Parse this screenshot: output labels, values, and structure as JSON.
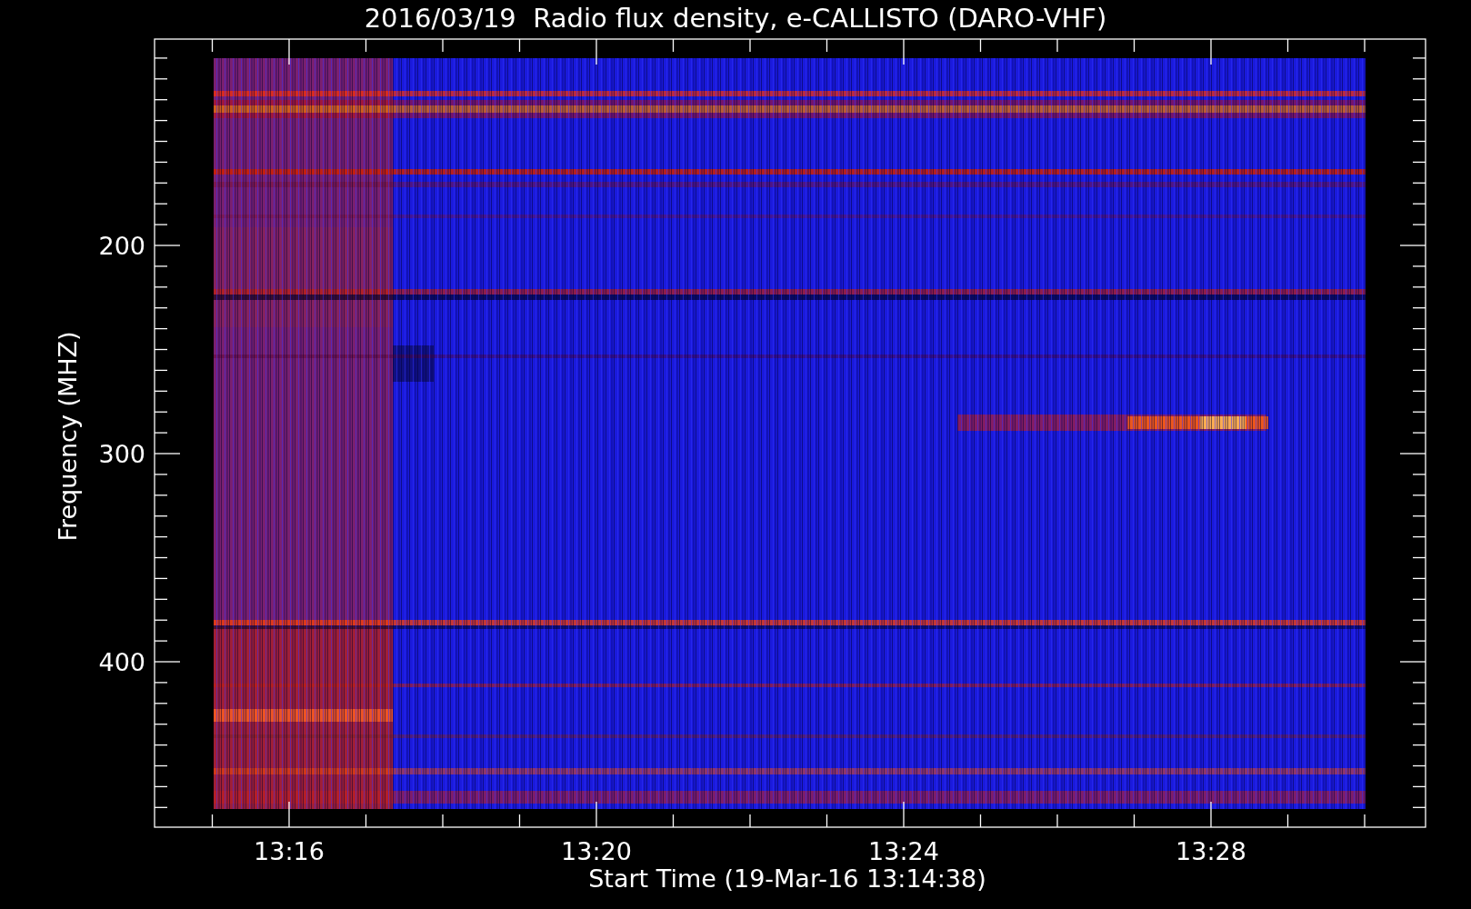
{
  "title": "2016/03/19  Radio flux density, e-CALLISTO (DARO-VHF)",
  "y_axis": {
    "label": "Frequency (MHZ)",
    "ticks": [
      "200",
      "300",
      "400"
    ]
  },
  "x_axis": {
    "label": "Start Time (19-Mar-16 13:14:38)",
    "ticks": [
      "13:16",
      "13:20",
      "13:24",
      "13:28"
    ]
  }
}
